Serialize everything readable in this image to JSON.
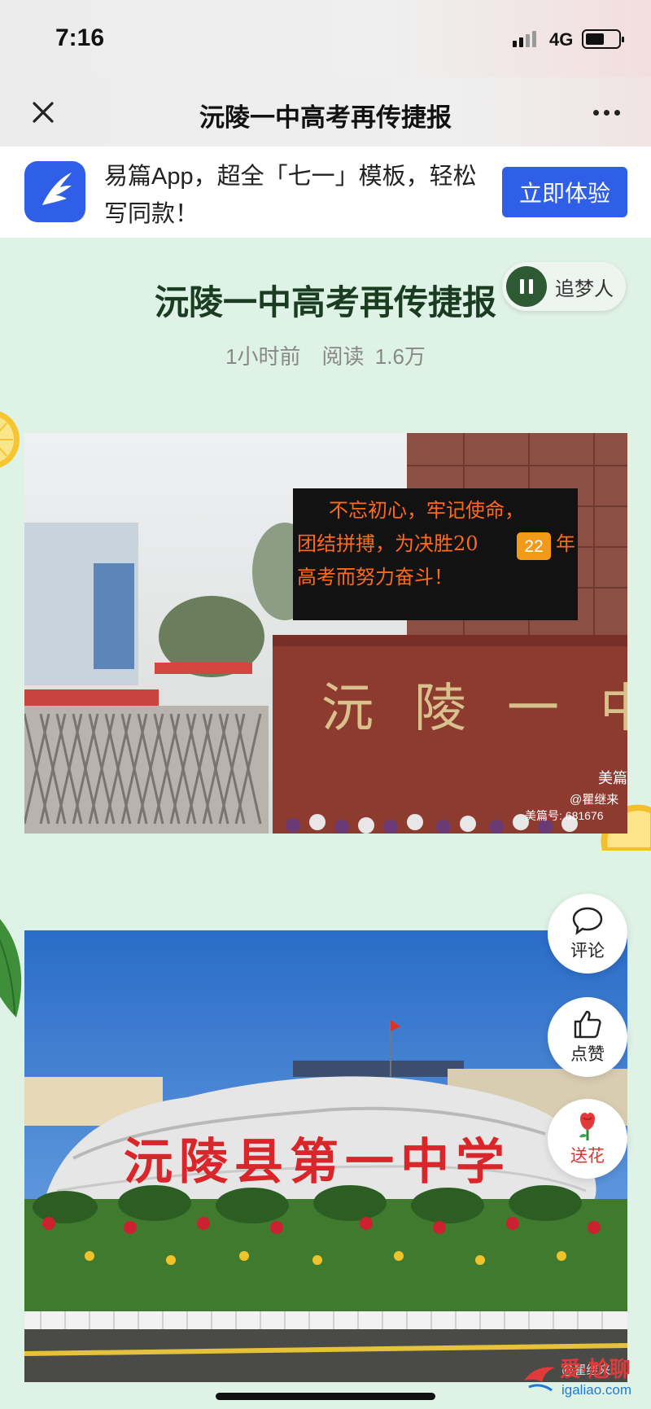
{
  "status_bar": {
    "time": "7:16",
    "network": "4G"
  },
  "nav": {
    "title": "沅陵一中高考再传捷报",
    "close_icon": "close-icon",
    "more_icon": "more-icon"
  },
  "banner": {
    "text": "易篇App，超全「七一」模板，轻松写同款！",
    "button_label": "立即体验",
    "accent": "#2f5fe8"
  },
  "article": {
    "title": "沅陵一中高考再传捷报",
    "meta": "1小时前　阅读 1.6万",
    "music_label": "追梦人"
  },
  "photo1": {
    "led_lines": [
      "不忘初心，牢记使命，",
      "团结拼搏，为决胜20",
      "年",
      "高考而努力奋斗！"
    ],
    "led_badge": "22",
    "gate_text": "沅陵一中",
    "logo_text": "美篇",
    "credit": "@瞿继来",
    "id_text": "美篇号: 681676"
  },
  "photo2": {
    "stone_text": "沅陵县第一中学",
    "credit": "@瞿继来"
  },
  "actions": {
    "comment": "评论",
    "like": "点赞",
    "flower": "送花"
  },
  "watermark": {
    "main": "爱·尬聊",
    "sub": "igaliao.com"
  },
  "colors": {
    "page_bg": "#dff2e6",
    "title_green": "#1a3d22",
    "led_text": "#ff6a1a",
    "stone_red": "#d8262a"
  }
}
